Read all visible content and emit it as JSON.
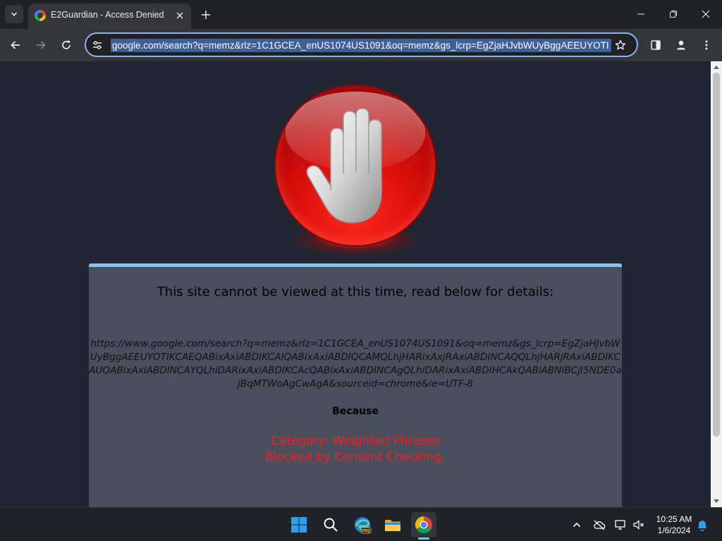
{
  "browser": {
    "tab": {
      "title": "E2Guardian - Access Denied"
    },
    "omnibox": {
      "url": "google.com/search?q=memz&rlz=1C1GCEA_enUS1074US1091&oq=memz&gs_lcrp=EgZjaHJvbWUyBggAEEUYOTI"
    }
  },
  "page": {
    "heading": "This site cannot be viewed at this time, read below for details:",
    "blocked_url": "https://www.google.com/search?q=memz&rlz=1C1GCEA_enUS1074US1091&oq=memz&gs_lcrp=EgZjaHJvbWUyBggAEEUYOTIKCAEQABixAxiABDIKCAIQABixAxiABDIQCAMQLhjHARixAxjRAxiABDINCAQQLhjHARjRAxiABDIKCAUQABixAxiABDINCAYQLhiDARixAxiABDIKCAcQABixAxiABDINCAgQLhiDARixAxiABDIHCAkQABiABNIBCjI5NDE0ajBqMTWoAgCwAgA&sourceid=chrome&ie=UTF-8",
    "because": "Because",
    "reason_category": "Category: Weighted Phrases",
    "reason_detail": "Blocked by Content Checking."
  },
  "taskbar": {
    "apps": [
      "start",
      "search",
      "edge-beta",
      "file-explorer",
      "chrome"
    ],
    "active_app": "chrome",
    "time": "10:25 AM",
    "date": "1/6/2024"
  },
  "colors": {
    "accent": "#8ab4f8",
    "panel_bg": "#4a4f5e",
    "page_bg": "#222632",
    "reason_red": "#ff1a1a"
  }
}
